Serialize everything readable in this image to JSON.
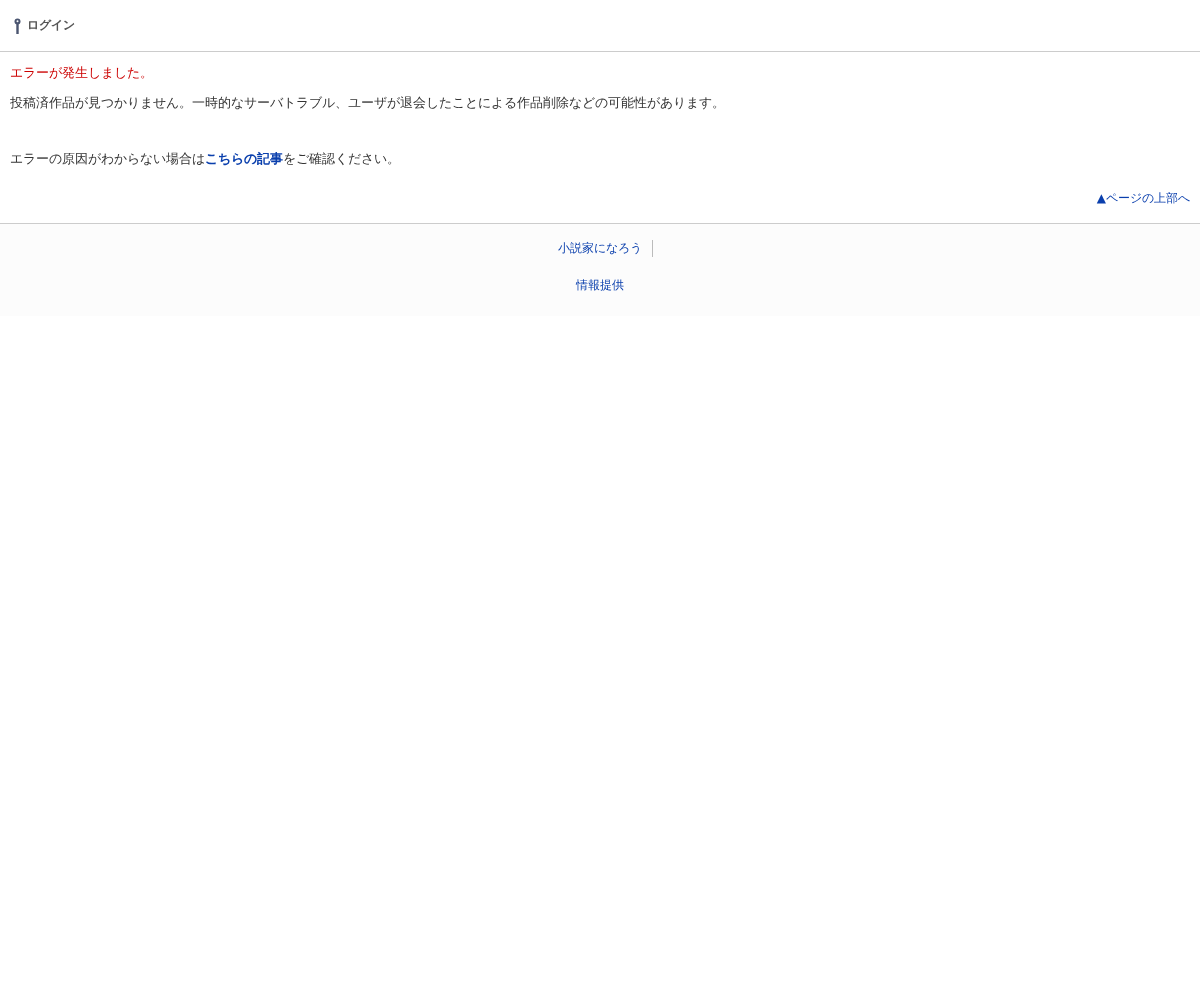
{
  "header": {
    "login_link": "ログイン"
  },
  "error": {
    "title": "エラーが発生しました。",
    "message": "投稿済作品が見つかりません。一時的なサーバトラブル、ユーザが退会したことによる作品削除などの可能性があります。",
    "help": {
      "before": "エラーの原因がわからない場合は",
      "link": "こちらの記事",
      "after": "をご確認ください。"
    }
  },
  "page_top_link": "▲ページの上部へ",
  "footer": {
    "links": [
      "小説家になろう"
    ],
    "info_link": "情報提供"
  }
}
